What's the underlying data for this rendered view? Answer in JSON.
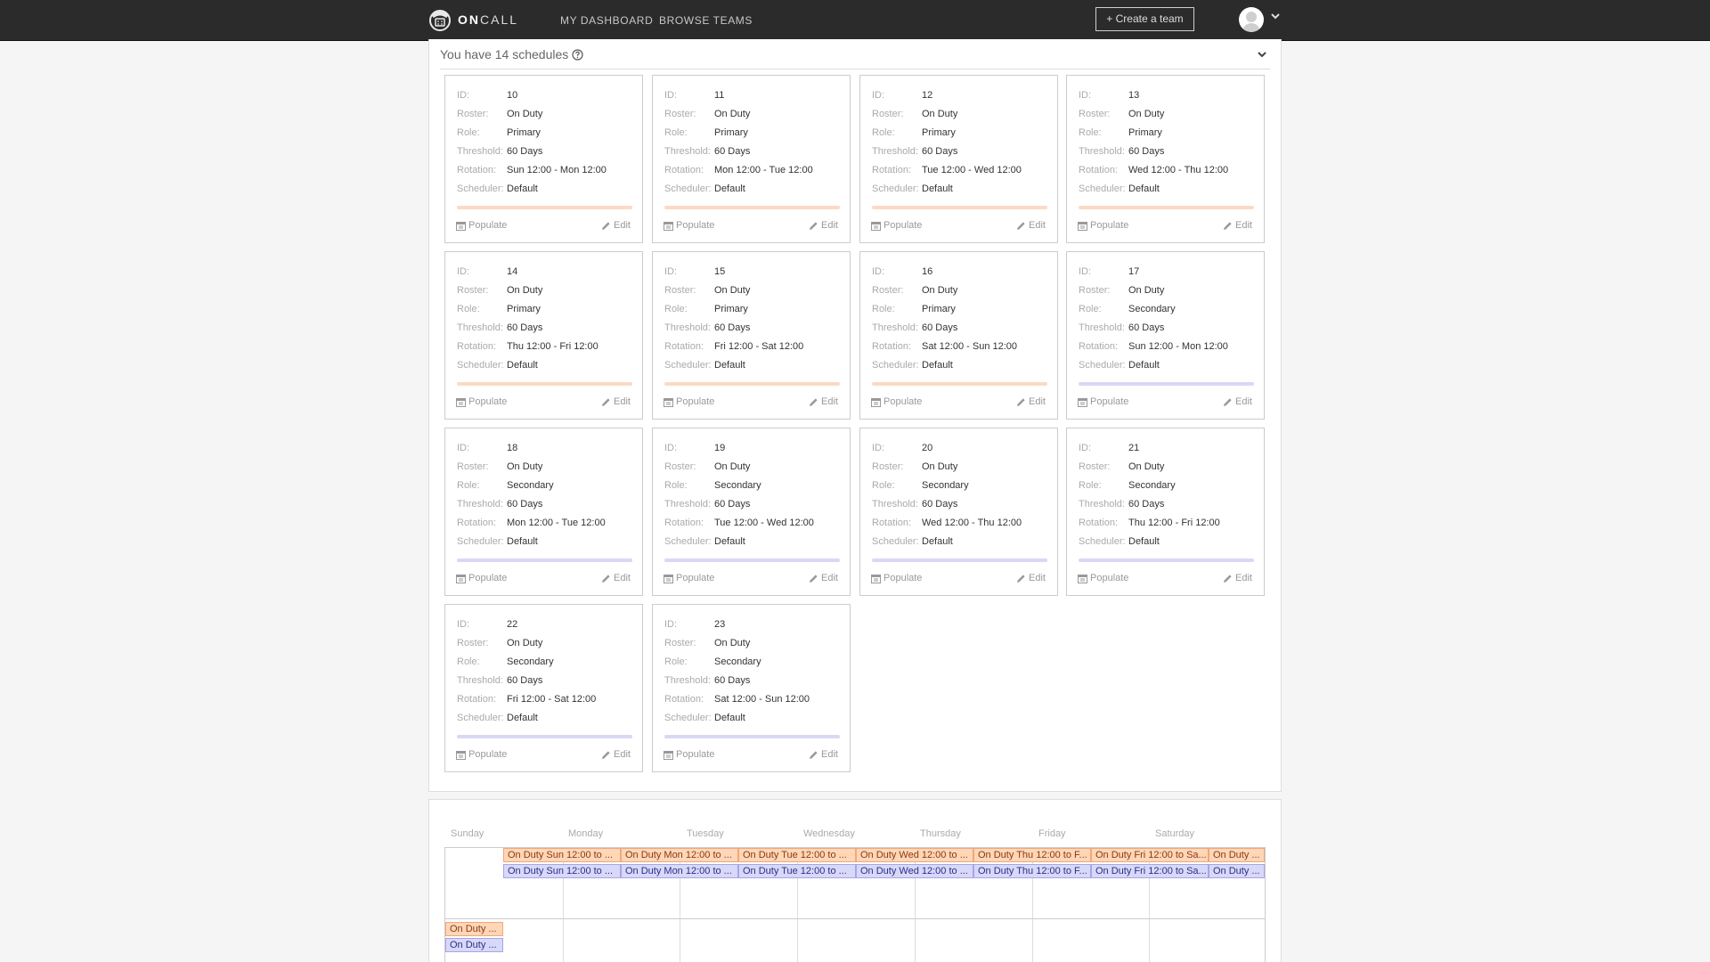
{
  "nav": {
    "logo_prefix": "ON",
    "logo_suffix": "CALL",
    "links": [
      "MY DASHBOARD",
      "BROWSE TEAMS"
    ],
    "create_team": "+ Create a team"
  },
  "schedules": {
    "title": "You have 14 schedules",
    "labels": {
      "id": "ID:",
      "roster": "Roster:",
      "role": "Role:",
      "threshold": "Threshold:",
      "rotation": "Rotation:",
      "scheduler": "Scheduler:"
    },
    "populate_label": "Populate",
    "edit_label": "Edit",
    "primary_bar_color": "#fdd9c3",
    "secondary_bar_color": "#d8d8f6",
    "items": [
      {
        "id": "10",
        "roster": "On Duty",
        "role": "Primary",
        "threshold": "60 Days",
        "rotation": "Sun 12:00 - Mon 12:00",
        "scheduler": "Default"
      },
      {
        "id": "11",
        "roster": "On Duty",
        "role": "Primary",
        "threshold": "60 Days",
        "rotation": "Mon 12:00 - Tue 12:00",
        "scheduler": "Default"
      },
      {
        "id": "12",
        "roster": "On Duty",
        "role": "Primary",
        "threshold": "60 Days",
        "rotation": "Tue 12:00 - Wed 12:00",
        "scheduler": "Default"
      },
      {
        "id": "13",
        "roster": "On Duty",
        "role": "Primary",
        "threshold": "60 Days",
        "rotation": "Wed 12:00 - Thu 12:00",
        "scheduler": "Default"
      },
      {
        "id": "14",
        "roster": "On Duty",
        "role": "Primary",
        "threshold": "60 Days",
        "rotation": "Thu 12:00 - Fri 12:00",
        "scheduler": "Default"
      },
      {
        "id": "15",
        "roster": "On Duty",
        "role": "Primary",
        "threshold": "60 Days",
        "rotation": "Fri 12:00 - Sat 12:00",
        "scheduler": "Default"
      },
      {
        "id": "16",
        "roster": "On Duty",
        "role": "Primary",
        "threshold": "60 Days",
        "rotation": "Sat 12:00 - Sun 12:00",
        "scheduler": "Default"
      },
      {
        "id": "17",
        "roster": "On Duty",
        "role": "Secondary",
        "threshold": "60 Days",
        "rotation": "Sun 12:00 - Mon 12:00",
        "scheduler": "Default"
      },
      {
        "id": "18",
        "roster": "On Duty",
        "role": "Secondary",
        "threshold": "60 Days",
        "rotation": "Mon 12:00 - Tue 12:00",
        "scheduler": "Default"
      },
      {
        "id": "19",
        "roster": "On Duty",
        "role": "Secondary",
        "threshold": "60 Days",
        "rotation": "Tue 12:00 - Wed 12:00",
        "scheduler": "Default"
      },
      {
        "id": "20",
        "roster": "On Duty",
        "role": "Secondary",
        "threshold": "60 Days",
        "rotation": "Wed 12:00 - Thu 12:00",
        "scheduler": "Default"
      },
      {
        "id": "21",
        "roster": "On Duty",
        "role": "Secondary",
        "threshold": "60 Days",
        "rotation": "Thu 12:00 - Fri 12:00",
        "scheduler": "Default"
      },
      {
        "id": "22",
        "roster": "On Duty",
        "role": "Secondary",
        "threshold": "60 Days",
        "rotation": "Fri 12:00 - Sat 12:00",
        "scheduler": "Default"
      },
      {
        "id": "23",
        "roster": "On Duty",
        "role": "Secondary",
        "threshold": "60 Days",
        "rotation": "Sat 12:00 - Sun 12:00",
        "scheduler": "Default"
      }
    ]
  },
  "calendar": {
    "weekdays": [
      "Sunday",
      "Monday",
      "Tuesday",
      "Wednesday",
      "Thursday",
      "Friday",
      "Saturday"
    ],
    "primary_events": [
      "On Duty Sun 12:00 to ...",
      "On Duty Mon 12:00 to ...",
      "On Duty Tue 12:00 to ...",
      "On Duty Wed 12:00 to ...",
      "On Duty Thu 12:00 to F...",
      "On Duty Fri 12:00 to Sa...",
      "On Duty ..."
    ],
    "secondary_events": [
      "On Duty Sun 12:00 to ...",
      "On Duty Mon 12:00 to ...",
      "On Duty Tue 12:00 to ...",
      "On Duty Wed 12:00 to ...",
      "On Duty Thu 12:00 to F...",
      "On Duty Fri 12:00 to Sa...",
      "On Duty ..."
    ],
    "week2_events": [
      {
        "label": "On Duty ...",
        "kind": "primary"
      },
      {
        "label": "On Duty ...",
        "kind": "secondary"
      }
    ]
  }
}
